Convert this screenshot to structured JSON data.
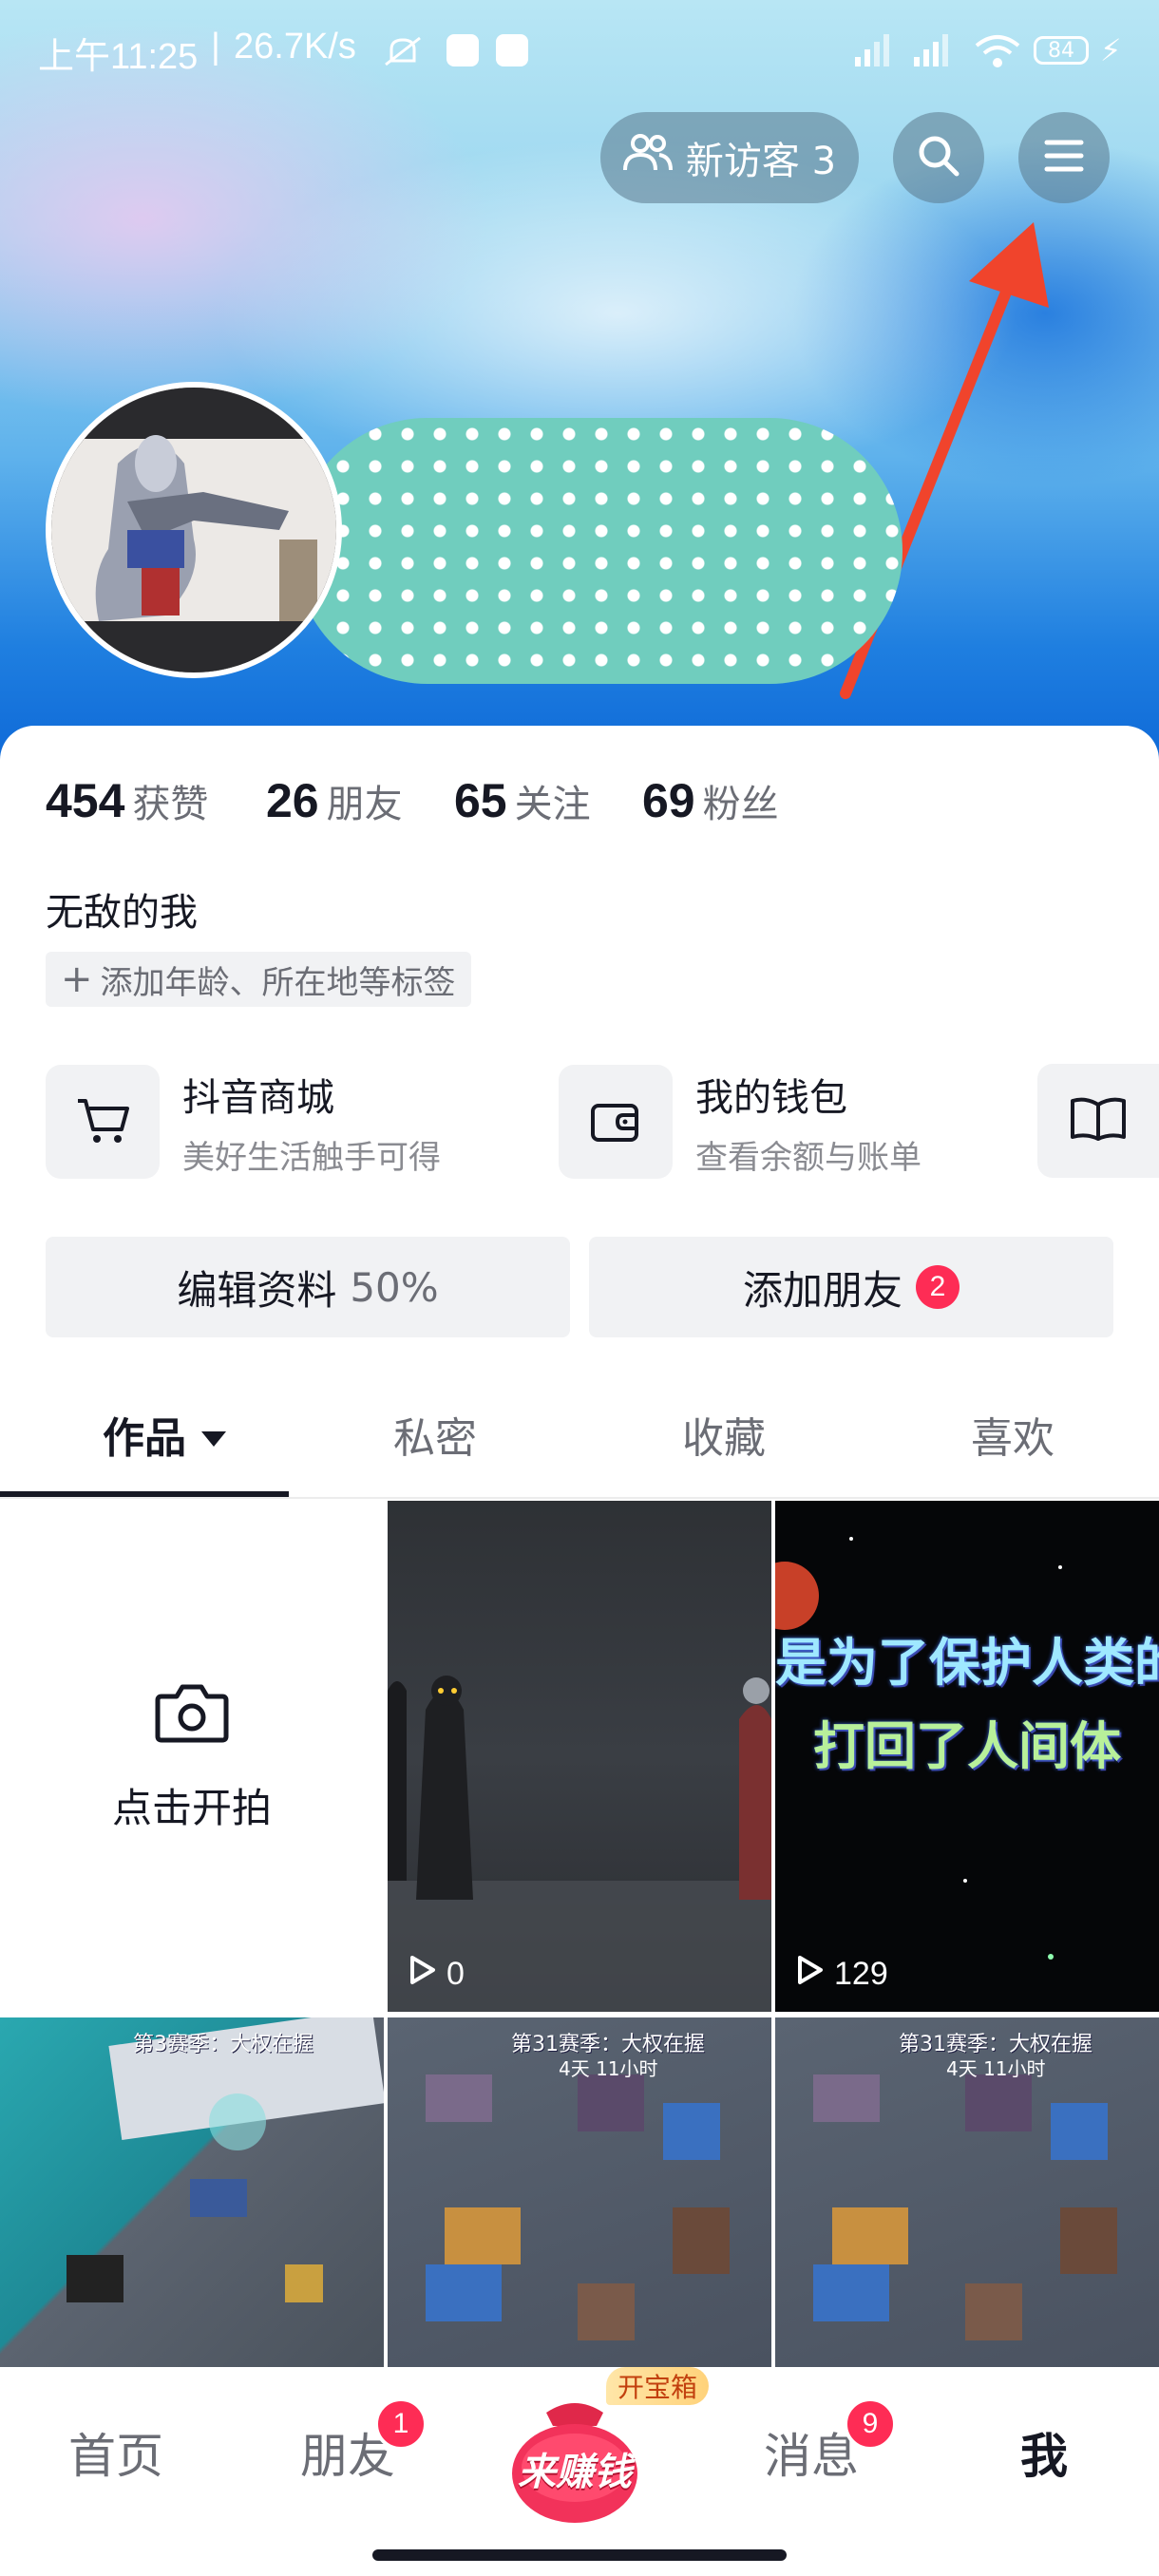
{
  "status_bar": {
    "time": "上午11:25",
    "net_speed": "26.7K/s",
    "battery": "84"
  },
  "header": {
    "visitor_label": "新访客 3"
  },
  "stats": [
    {
      "num": "454",
      "label": "获赞"
    },
    {
      "num": "26",
      "label": "朋友"
    },
    {
      "num": "65",
      "label": "关注"
    },
    {
      "num": "69",
      "label": "粉丝"
    }
  ],
  "profile": {
    "signature": "无敌的我",
    "add_tags": "添加年龄、所在地等标签"
  },
  "tools": [
    {
      "title": "抖音商城",
      "subtitle": "美好生活触手可得",
      "icon": "cart-icon"
    },
    {
      "title": "我的钱包",
      "subtitle": "查看余额与账单",
      "icon": "wallet-icon"
    },
    {
      "icon": "book-icon"
    }
  ],
  "buttons": {
    "edit_profile": "编辑资料",
    "edit_progress": "50%",
    "add_friends": "添加朋友",
    "add_friends_badge": "2"
  },
  "tabs": [
    "作品",
    "私密",
    "收藏",
    "喜欢"
  ],
  "grid": {
    "shoot_label": "点击开拍",
    "videos": [
      {
        "plays": "0"
      },
      {
        "plays": "129",
        "caption_line1": "是为了保护人类的",
        "caption_line2": "打回了人间体"
      },
      {
        "banner": "第3赛季：大权在握"
      },
      {
        "banner": "第31赛季：大权在握",
        "sub": "4天 11小时"
      },
      {
        "banner": "第31赛季：大权在握",
        "sub": "4天 11小时"
      }
    ]
  },
  "bottom_nav": {
    "home": "首页",
    "friends": "朋友",
    "friends_badge": "1",
    "earn": "来赚钱",
    "treasure": "开宝箱",
    "messages": "消息",
    "messages_badge": "9",
    "me": "我"
  },
  "colors": {
    "accent": "#fe2c55",
    "annotation_arrow": "#f0442c"
  }
}
